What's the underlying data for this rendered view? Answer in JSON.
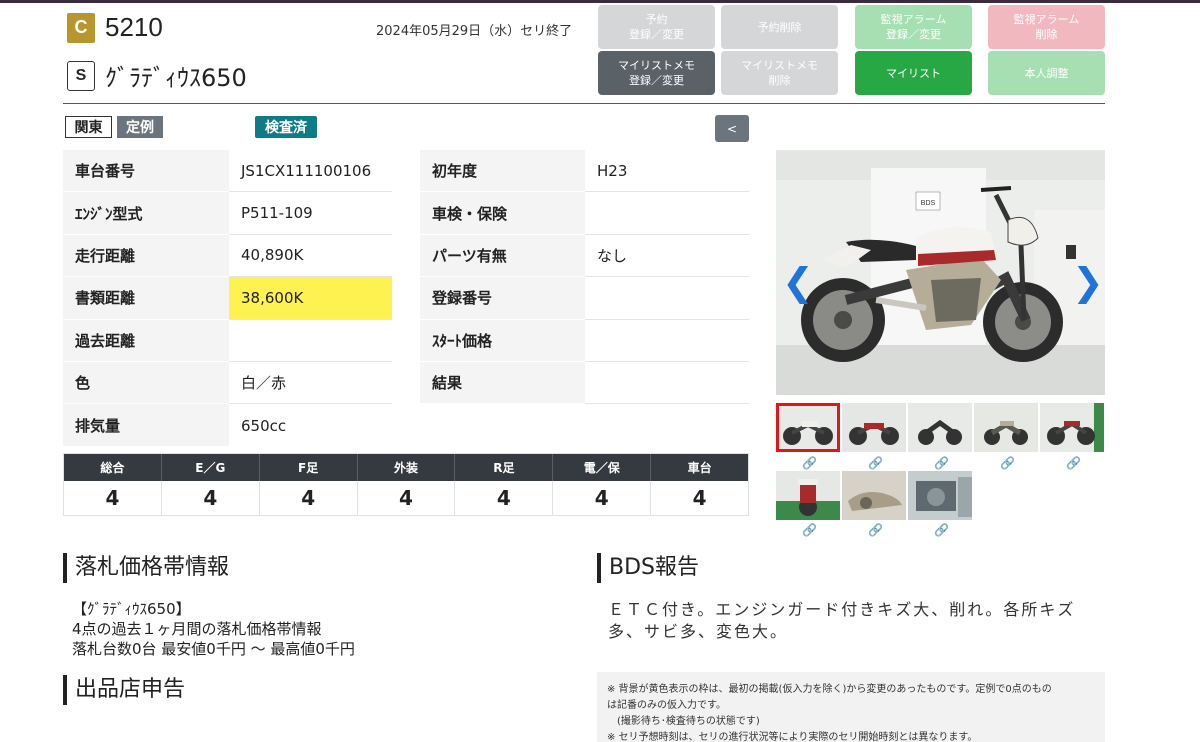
{
  "header": {
    "grade": "C",
    "lot_number": "5210",
    "auction_date": "2024年05月29日（水）セリ終了",
    "rank": "S",
    "bike_name": "ｸﾞﾗﾃﾞｨｳｽ650"
  },
  "actions": {
    "reserve": "予約\n登録／変更",
    "reserve_delete": "予約削除",
    "watch_alarm": "監視アラーム\n登録／変更",
    "watch_alarm_delete": "監視アラーム\n削除",
    "memo": "マイリストメモ\n登録／変更",
    "memo_delete": "マイリストメモ\n削除",
    "mylist": "マイリスト",
    "self_adjust": "本人調整"
  },
  "tags": {
    "region": "関東",
    "type": "定例",
    "inspection": "検査済",
    "prev": "<"
  },
  "specs": {
    "frame_no_label": "車台番号",
    "frame_no": "JS1CX111100106",
    "year_label": "初年度",
    "year": "H23",
    "engine_label": "ｴﾝｼﾞﾝ型式",
    "engine": "P511-109",
    "inspection_label": "車検・保険",
    "inspection": "",
    "mileage_label": "走行距離",
    "mileage": "40,890K",
    "parts_label": "パーツ有無",
    "parts": "なし",
    "doc_mileage_label": "書類距離",
    "doc_mileage": "38,600K",
    "reg_no_label": "登録番号",
    "reg_no": "",
    "past_mileage_label": "過去距離",
    "past_mileage": "",
    "start_price_label": "ｽﾀｰﾄ価格",
    "start_price": "",
    "color_label": "色",
    "color": "白／赤",
    "result_label": "結果",
    "result": "",
    "displacement_label": "排気量",
    "displacement": "650cc"
  },
  "scores": {
    "headers": [
      "総合",
      "E／G",
      "F足",
      "外装",
      "R足",
      "電／保",
      "車台"
    ],
    "values": [
      "4",
      "4",
      "4",
      "4",
      "4",
      "4",
      "4"
    ]
  },
  "price_info": {
    "title": "落札価格帯情報",
    "line1": "【ｸﾞﾗﾃﾞｨｳｽ650】",
    "line2": "4点の過去１ヶ月間の落札価格帯情報",
    "line3": "落札台数0台 最安値0千円 〜 最高値0千円"
  },
  "bds": {
    "title": "BDS報告",
    "text": "ＥＴＣ付き。エンジンガード付きキズ大、削れ。各所キズ多、サビ多、変色大。"
  },
  "seller": {
    "title": "出品店申告"
  },
  "notes": [
    "※ 背景が黄色表示の枠は、最初の掲載(仮入力を除く)から変更のあったものです。定例で0点のもの",
    "は記番のみの仮入力です。",
    "　(撮影待ち･検査待ちの状態です)",
    "※ セリ予想時刻は、セリの進行状況等により実際のセリ開始時刻とは異なります。"
  ],
  "colors": {
    "grade_c": "#b8962e",
    "highlight": "#fef250",
    "inspection_tag": "#0e7c86",
    "mylist_green": "#28a745",
    "score_header": "#343a40",
    "selected_thumb": "#e01717"
  }
}
